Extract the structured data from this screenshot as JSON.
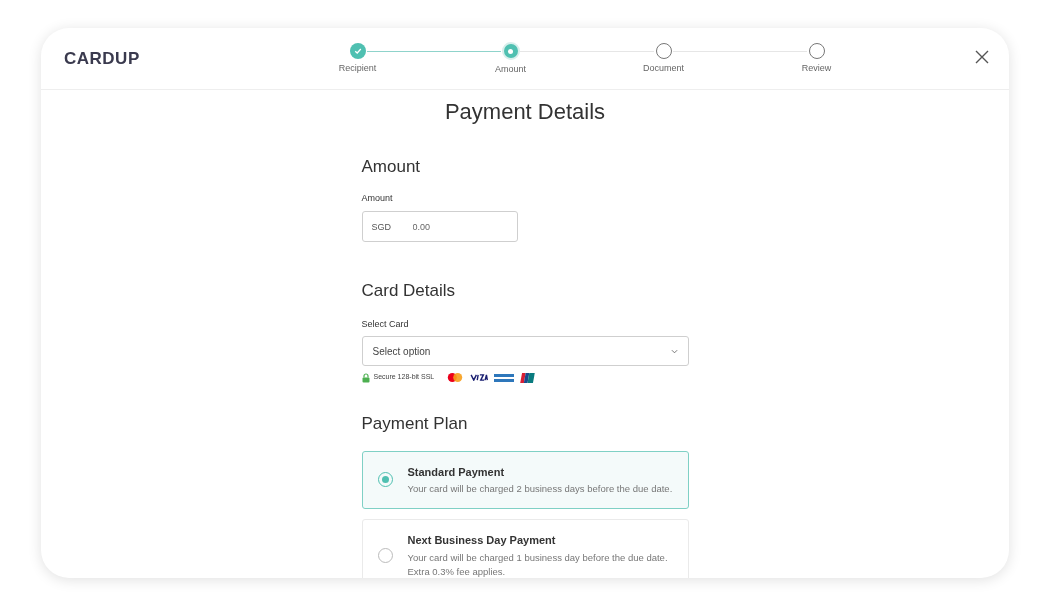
{
  "header": {
    "logo": "CARDUP",
    "steps": [
      {
        "label": "Recipient",
        "complete": true,
        "selected": false
      },
      {
        "label": "Amount",
        "complete": false,
        "selected": true
      },
      {
        "label": "Document",
        "complete": false,
        "selected": false
      },
      {
        "label": "Review",
        "complete": false,
        "selected": false
      }
    ]
  },
  "title": "Payment Details",
  "amount_section": {
    "heading": "Amount",
    "label": "Amount",
    "currency": "SGD",
    "placeholder": "0.00"
  },
  "card_section": {
    "heading": "Card Details",
    "label": "Select Card",
    "select_placeholder": "Select option",
    "secure_text": "Secure 128-bit SSL"
  },
  "plan_section": {
    "heading": "Payment Plan",
    "options": [
      {
        "title": "Standard Payment",
        "description": "Your card will be charged 2 business days before the due date.",
        "selected": true
      },
      {
        "title": "Next Business Day Payment",
        "description": "Your card will be charged 1 business day before the due date.\nExtra 0.3% fee applies.",
        "selected": false
      }
    ]
  }
}
